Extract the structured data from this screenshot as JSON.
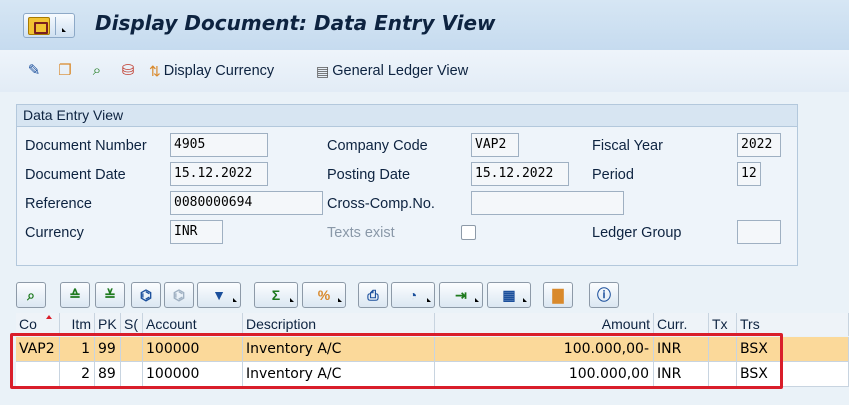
{
  "title": "Display Document: Data Entry View",
  "toolbar": {
    "display_currency_label": "Display Currency",
    "general_ledger_view_label": "General Ledger View"
  },
  "groupbox": {
    "header": "Data Entry View",
    "fields": {
      "document_number_label": "Document Number",
      "document_number_value": "4905",
      "company_code_label": "Company Code",
      "company_code_value": "VAP2",
      "fiscal_year_label": "Fiscal Year",
      "fiscal_year_value": "2022",
      "document_date_label": "Document Date",
      "document_date_value": "15.12.2022",
      "posting_date_label": "Posting Date",
      "posting_date_value": "15.12.2022",
      "period_label": "Period",
      "period_value": "12",
      "reference_label": "Reference",
      "reference_value": "0080000694",
      "cross_comp_label": "Cross-Comp.No.",
      "cross_comp_value": "",
      "currency_label": "Currency",
      "currency_value": "INR",
      "texts_exist_label": "Texts exist",
      "ledger_group_label": "Ledger Group",
      "ledger_group_value": ""
    }
  },
  "grid": {
    "columns": [
      "Co",
      "Itm",
      "PK",
      "S(",
      "Account",
      "Description",
      "Amount",
      "Curr.",
      "Tx",
      "Trs"
    ],
    "rows": [
      [
        "VAP2",
        "1",
        "99",
        "",
        "100000",
        "Inventory A/C",
        "100.000,00-",
        "INR",
        "",
        "BSX"
      ],
      [
        "",
        "2",
        "89",
        "",
        "100000",
        "Inventory A/C",
        "100.000,00",
        "INR",
        "",
        "BSX"
      ]
    ]
  },
  "colors": {
    "accent_highlight": "#d91e2a",
    "selected_row": "#fbd99a",
    "background": "#eaf2f8"
  }
}
